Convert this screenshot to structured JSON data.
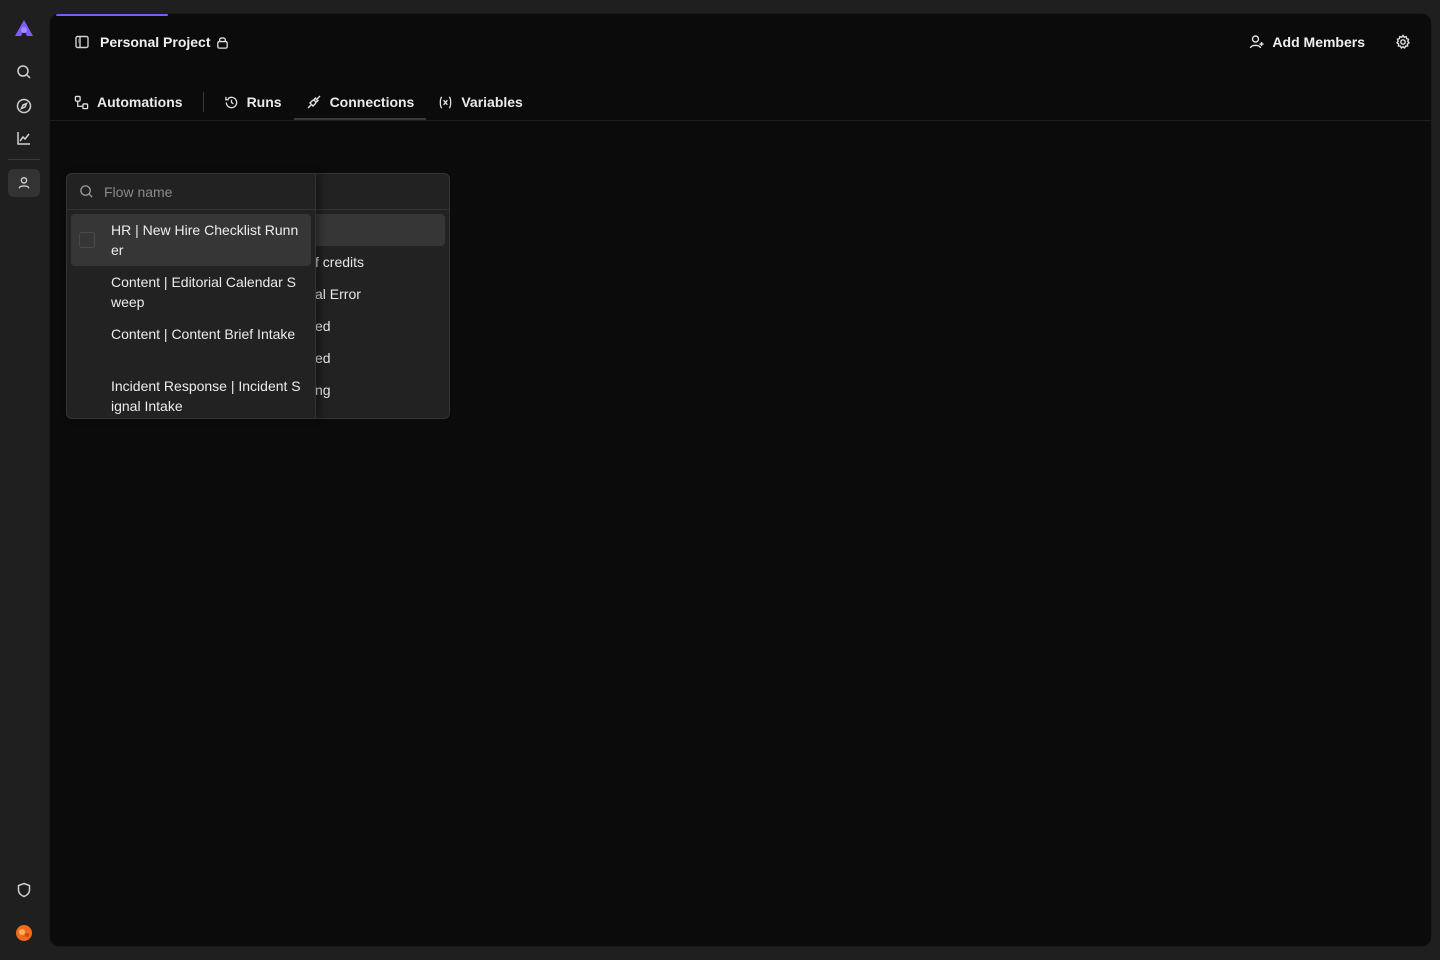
{
  "rail": {
    "items": [
      {
        "icon": "logo-icon"
      },
      {
        "icon": "search-icon"
      },
      {
        "icon": "compass-icon"
      },
      {
        "icon": "chart-line-icon"
      },
      {
        "icon": "user-icon",
        "active": true
      },
      {
        "icon": "shield-icon"
      },
      {
        "icon": "avatar-icon"
      }
    ],
    "accent": "#7c5cff",
    "avatar_color": "#f26b1d"
  },
  "header": {
    "project_title": "Personal Project",
    "add_members_label": "Add Members"
  },
  "tabs": [
    {
      "label": "Automations",
      "icon": "automations-icon"
    },
    {
      "label": "Runs",
      "icon": "history-icon"
    },
    {
      "label": "Connections",
      "icon": "plug-icon",
      "active": true
    },
    {
      "label": "Variables",
      "icon": "variable-icon"
    }
  ],
  "flow_filter": {
    "search_placeholder": "Flow name",
    "search_value": "",
    "items": [
      "HR | New Hire Checklist Runner",
      "Content | Editorial Calendar Sweep",
      "Content | Content Brief Intake",
      "Incident Response | Incident Signal Intake"
    ]
  },
  "status_filter": {
    "visible_fragments": [
      "f credits",
      "al Error",
      "ed",
      "ed",
      "ng"
    ]
  }
}
